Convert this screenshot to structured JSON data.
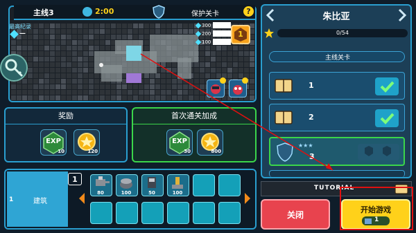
{
  "stage": {
    "name": "主线3",
    "timer": "2:00",
    "mode_label": "保护关卡",
    "help_icon": "question-icon"
  },
  "record": {
    "title": "最高纪录",
    "value": "—"
  },
  "resources": [
    "300",
    "200",
    "100"
  ],
  "rank_badge": "1",
  "rewards": {
    "title": "奖励",
    "exp_label": "EXP",
    "exp_value": "10",
    "coin_value": "120"
  },
  "first_clear": {
    "title": "首次通关加成",
    "exp_label": "EXP",
    "exp_value": "30",
    "coin_value": "800"
  },
  "build": {
    "slot_index": "1",
    "tab_number": "1",
    "tab_label": "建筑",
    "items": [
      "80",
      "100",
      "50",
      "100"
    ]
  },
  "right": {
    "title": "朱比亚",
    "progress": "0/54",
    "section": "主线关卡",
    "levels": [
      {
        "number": "1",
        "completed": true
      },
      {
        "number": "2",
        "completed": true
      },
      {
        "number": "3",
        "completed": false
      }
    ]
  },
  "tutorial_label": "TUTORIAL",
  "close_label": "关闭",
  "start_label": "开始游戏",
  "start_cost": "1",
  "colors": {
    "accent": "#2a9fd0",
    "green": "#3bd64a",
    "red": "#e8434e",
    "yellow": "#ffd11a",
    "annotation": "#e01010"
  }
}
